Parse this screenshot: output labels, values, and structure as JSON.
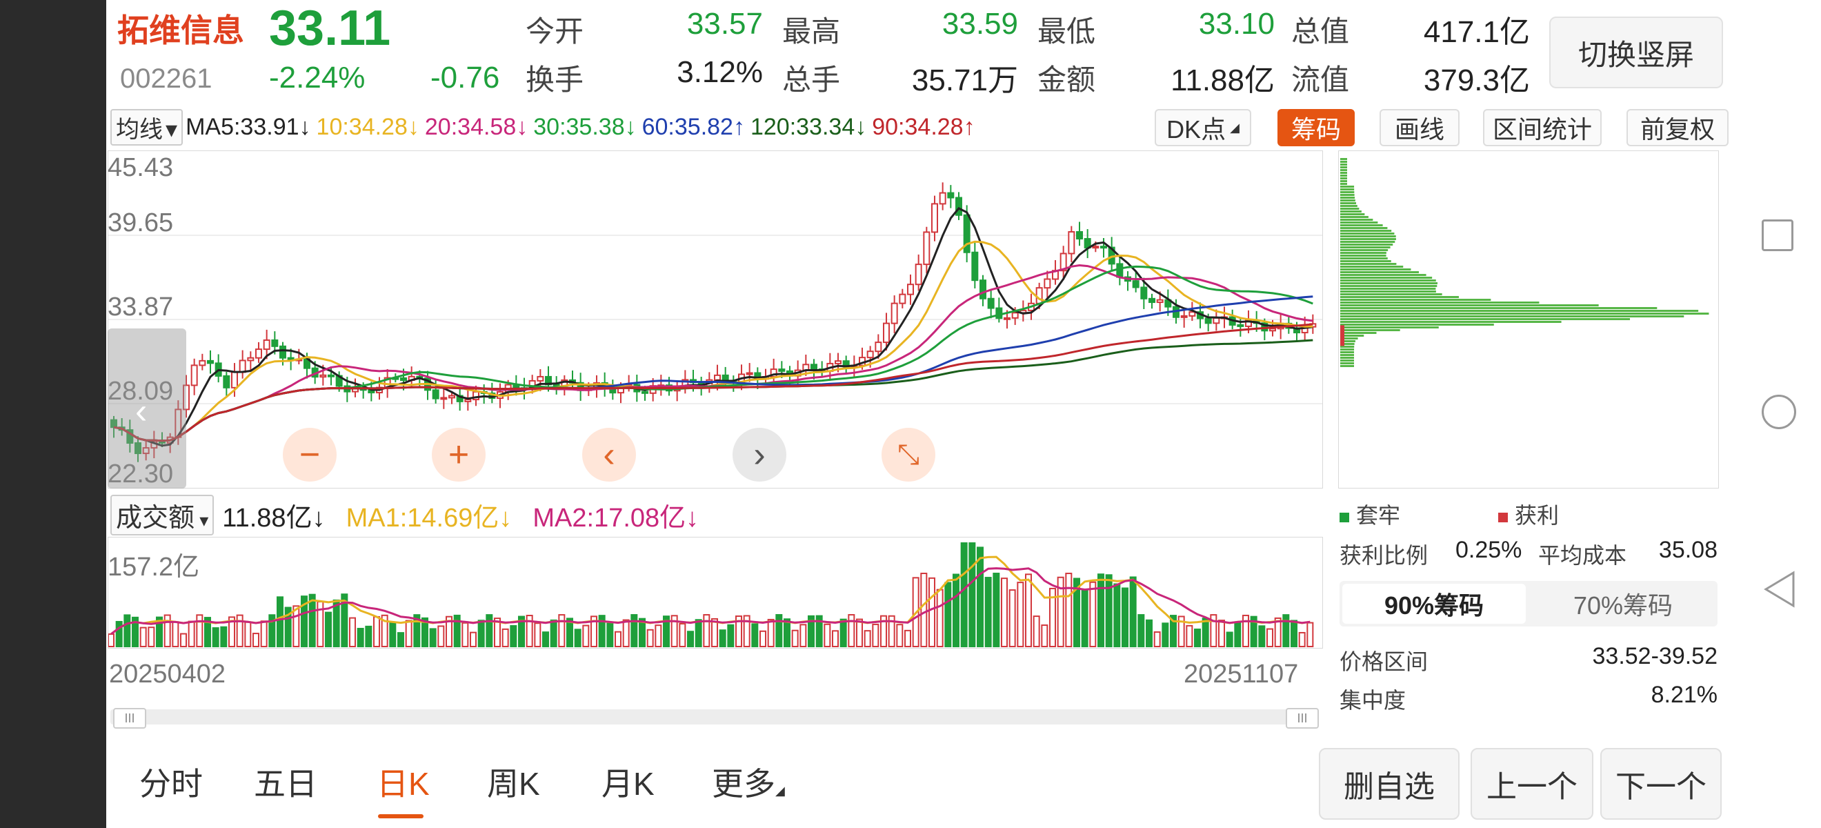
{
  "stock": {
    "name": "拓维信息",
    "price": "33.11",
    "code": "002261",
    "change_pct": "-2.24%",
    "change": "-0.76"
  },
  "quote": [
    {
      "label": "今开",
      "value": "33.57",
      "color": "green"
    },
    {
      "label": "最高",
      "value": "33.59",
      "color": "green"
    },
    {
      "label": "最低",
      "value": "33.10",
      "color": "green"
    },
    {
      "label": "总值",
      "value": "417.1亿",
      "color": "dark"
    },
    {
      "label": "换手",
      "value": "3.12%",
      "color": "dark"
    },
    {
      "label": "总手",
      "value": "35.71万",
      "color": "dark"
    },
    {
      "label": "金额",
      "value": "11.88亿",
      "color": "dark"
    },
    {
      "label": "流值",
      "value": "379.3亿",
      "color": "dark"
    }
  ],
  "switch_button": "切换竖屏",
  "ma_bar": {
    "selector": "均线",
    "items": [
      {
        "text": "MA5:33.91↓",
        "color": "#222222"
      },
      {
        "text": "10:34.28↓",
        "color": "#e8b422"
      },
      {
        "text": "20:34.58↓",
        "color": "#c8267a"
      },
      {
        "text": "30:35.38↓",
        "color": "#1e9f3b"
      },
      {
        "text": "60:35.82↑",
        "color": "#1f3fae"
      },
      {
        "text": "120:33.34↓",
        "color": "#1a5e1a"
      },
      {
        "text": "90:34.28↑",
        "color": "#c0262b"
      }
    ]
  },
  "toolbar": {
    "dk": "DK点",
    "chips": "筹码",
    "draw": "画线",
    "range": "区间统计",
    "adjust": "前复权"
  },
  "kline_axis": [
    "45.43",
    "39.65",
    "33.87",
    "28.09",
    "22.30"
  ],
  "controls": {
    "zoom_out": "−",
    "zoom_in": "+",
    "prev": "‹",
    "next": "›",
    "collapse": "⤡"
  },
  "volume": {
    "selector": "成交额",
    "value": "11.88亿↓",
    "ma1": "MA1:14.69亿↓",
    "ma2": "MA2:17.08亿↓",
    "axis_max": "157.2亿"
  },
  "dates": {
    "start": "20250402",
    "end": "20251107"
  },
  "chip_panel": {
    "legend_trapped": "套牢",
    "legend_profit": "获利",
    "profit_ratio_label": "获利比例",
    "profit_ratio": "0.25%",
    "avg_cost_label": "平均成本",
    "avg_cost": "35.08",
    "tab_90": "90%筹码",
    "tab_70": "70%筹码",
    "price_range_label": "价格区间",
    "price_range": "33.52-39.52",
    "concentration_label": "集中度",
    "concentration": "8.21%"
  },
  "periods": [
    "分时",
    "五日",
    "日K",
    "周K",
    "月K",
    "更多"
  ],
  "active_period": "日K",
  "actions": {
    "remove": "删自选",
    "prev": "上一个",
    "next": "下一个"
  },
  "colors": {
    "up": "#d2383d",
    "down": "#1e9f3b",
    "accent": "#e55512"
  }
}
